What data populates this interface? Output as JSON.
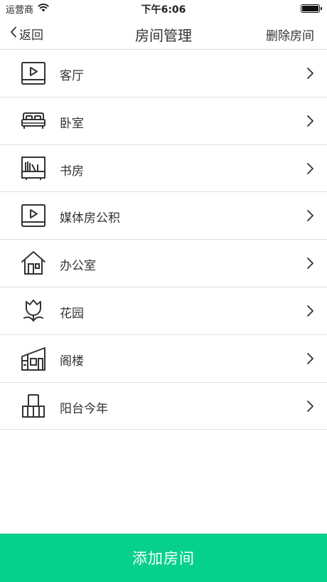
{
  "status_bar": {
    "carrier": "运营商",
    "time": "下午6:06"
  },
  "nav": {
    "back_label": "返回",
    "title": "房间管理",
    "right_action": "删除房间"
  },
  "rooms": [
    {
      "label": "客厅",
      "icon": "tv-icon"
    },
    {
      "label": "卧室",
      "icon": "bed-icon"
    },
    {
      "label": "书房",
      "icon": "bookshelf-icon"
    },
    {
      "label": "媒体房公积",
      "icon": "tv-icon"
    },
    {
      "label": "办公室",
      "icon": "house-icon"
    },
    {
      "label": "花园",
      "icon": "flower-icon"
    },
    {
      "label": "阁楼",
      "icon": "attic-icon"
    },
    {
      "label": "阳台今年",
      "icon": "balcony-icon"
    }
  ],
  "add_button_label": "添加房间",
  "colors": {
    "accent": "#07d08e",
    "divider": "#e0e0e0",
    "text": "#333333"
  }
}
